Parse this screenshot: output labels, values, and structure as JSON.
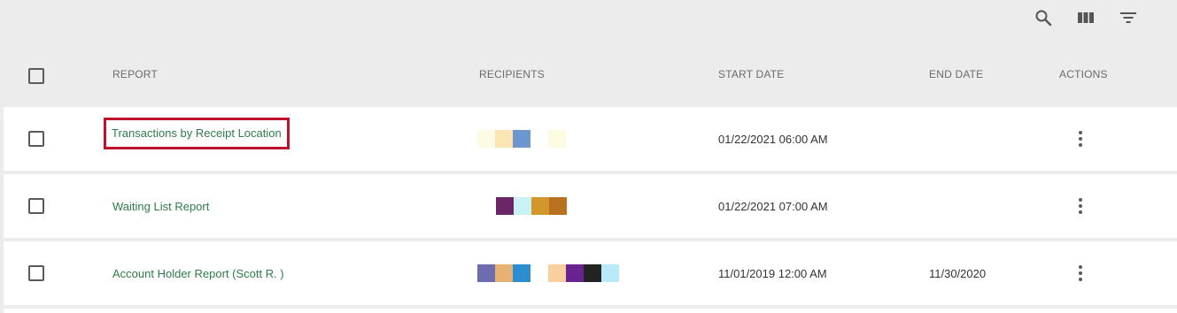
{
  "toolbar": {
    "icons": [
      "search-icon",
      "columns-icon",
      "filter-icon"
    ]
  },
  "table": {
    "headers": {
      "report": "REPORT",
      "recipients": "RECIPIENTS",
      "start_date": "START DATE",
      "end_date": "END DATE",
      "actions": "ACTIONS"
    },
    "rows": [
      {
        "report": "Transactions by Receipt Location",
        "highlighted": true,
        "recipient_colors": [
          "#fdfbe5",
          "#fbe6b3",
          "#6d97cf",
          "#ffffff",
          "#fdfbe2"
        ],
        "start_date": "01/22/2021 06:00 AM",
        "end_date": ""
      },
      {
        "report": "Waiting List Report",
        "highlighted": false,
        "recipient_colors": [
          "#6b2667",
          "#c9f2f4",
          "#d1972a",
          "#b8711f"
        ],
        "start_date": "01/22/2021 07:00 AM",
        "end_date": ""
      },
      {
        "report": "Account Holder Report (Scott R. )",
        "highlighted": false,
        "recipient_colors": [
          "#6c6cae",
          "#e6b173",
          "#2b8ed0",
          "#ffffff",
          "#f8cf9f",
          "#6b2293",
          "#232323",
          "#b7ebfa"
        ],
        "start_date": "11/01/2019 12:00 AM",
        "end_date": "11/30/2020"
      }
    ]
  },
  "colors": {
    "accent_link": "#2e7d4a",
    "highlight_border": "#c0112b",
    "background": "#ececec"
  }
}
